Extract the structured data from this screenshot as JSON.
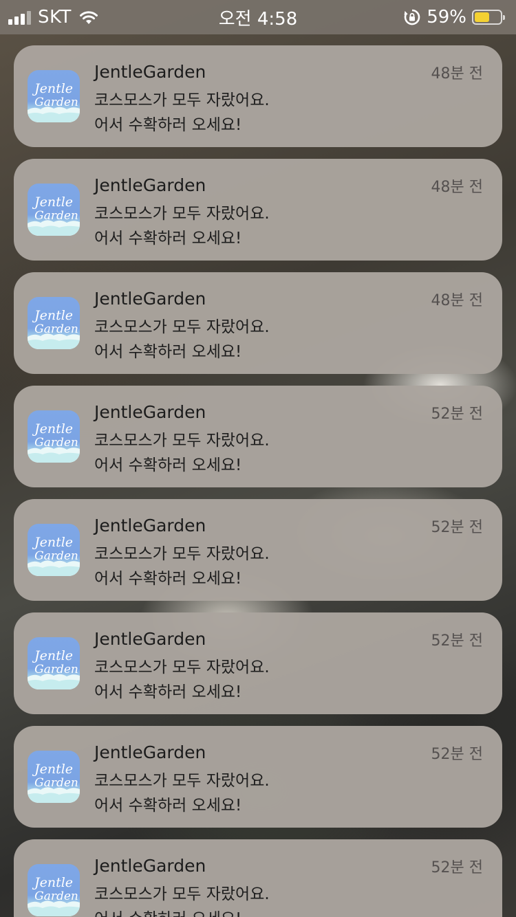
{
  "status_bar": {
    "carrier": "SKT",
    "time": "오전 4:58",
    "battery_percent": "59%",
    "battery_level": 0.59,
    "battery_color": "#f4d132"
  },
  "notifications": [
    {
      "app": "JentleGarden",
      "time_ago": "48분 전",
      "line1": "코스모스가 모두 자랐어요.",
      "line2": "어서 수확하러 오세요!"
    },
    {
      "app": "JentleGarden",
      "time_ago": "48분 전",
      "line1": "코스모스가 모두 자랐어요.",
      "line2": "어서 수확하러 오세요!"
    },
    {
      "app": "JentleGarden",
      "time_ago": "48분 전",
      "line1": "코스모스가 모두 자랐어요.",
      "line2": "어서 수확하러 오세요!"
    },
    {
      "app": "JentleGarden",
      "time_ago": "52분 전",
      "line1": "코스모스가 모두 자랐어요.",
      "line2": "어서 수확하러 오세요!"
    },
    {
      "app": "JentleGarden",
      "time_ago": "52분 전",
      "line1": "코스모스가 모두 자랐어요.",
      "line2": "어서 수확하러 오세요!"
    },
    {
      "app": "JentleGarden",
      "time_ago": "52분 전",
      "line1": "코스모스가 모두 자랐어요.",
      "line2": "어서 수확하러 오세요!"
    },
    {
      "app": "JentleGarden",
      "time_ago": "52분 전",
      "line1": "코스모스가 모두 자랐어요.",
      "line2": "어서 수확하러 오세요!"
    },
    {
      "app": "JentleGarden",
      "time_ago": "52분 전",
      "line1": "코스모스가 모두 자랐어요.",
      "line2": "어서 수확하러 오세요!"
    }
  ],
  "app_icon": {
    "logo_text_line1": "Jentle",
    "logo_text_line2": "Garden",
    "icon_name": "jentlegarden-app-icon"
  }
}
